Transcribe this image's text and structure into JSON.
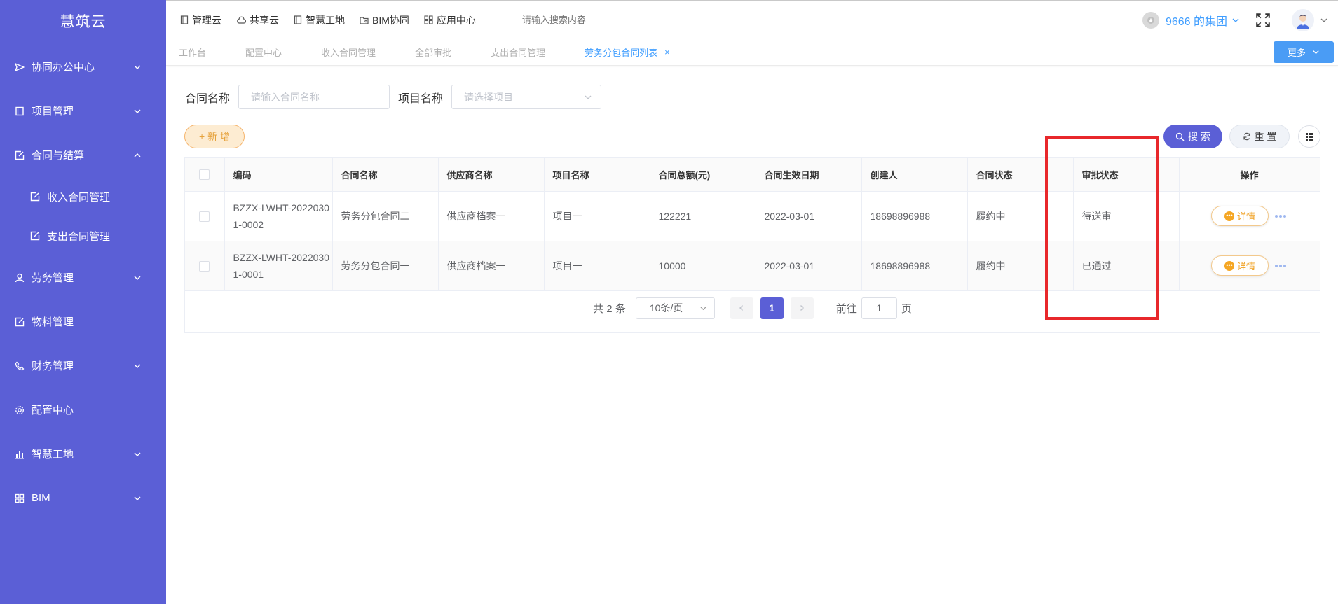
{
  "app": {
    "logo": "慧筑云"
  },
  "sidebar": {
    "items": [
      {
        "label": "协同办公中心",
        "icon": "send-icon",
        "expanded": false,
        "has_children": true
      },
      {
        "label": "项目管理",
        "icon": "book-icon",
        "expanded": false,
        "has_children": true
      },
      {
        "label": "合同与结算",
        "icon": "edit-doc-icon",
        "expanded": true,
        "has_children": true,
        "children": [
          {
            "label": "收入合同管理",
            "icon": "edit-doc-icon"
          },
          {
            "label": "支出合同管理",
            "icon": "edit-doc-icon"
          }
        ]
      },
      {
        "label": "劳务管理",
        "icon": "user-icon",
        "expanded": false,
        "has_children": true
      },
      {
        "label": "物料管理",
        "icon": "edit-doc-icon",
        "has_children": false
      },
      {
        "label": "财务管理",
        "icon": "phone-icon",
        "expanded": false,
        "has_children": true
      },
      {
        "label": "配置中心",
        "icon": "gear-icon",
        "has_children": false
      },
      {
        "label": "智慧工地",
        "icon": "bar-chart-icon",
        "expanded": false,
        "has_children": true
      },
      {
        "label": "BIM",
        "icon": "grid-icon",
        "expanded": false,
        "has_children": true
      }
    ]
  },
  "topnav": {
    "items": [
      {
        "label": "管理云",
        "icon": "doc-icon"
      },
      {
        "label": "共享云",
        "icon": "cloud-icon"
      },
      {
        "label": "智慧工地",
        "icon": "doc-icon"
      },
      {
        "label": "BIM协同",
        "icon": "folder-icon"
      },
      {
        "label": "应用中心",
        "icon": "apps-icon"
      }
    ],
    "search_placeholder": "请输入搜索内容",
    "org_name": "9666 的集团"
  },
  "tabs": {
    "items": [
      {
        "label": "工作台",
        "active": false
      },
      {
        "label": "配置中心",
        "active": false
      },
      {
        "label": "收入合同管理",
        "active": false
      },
      {
        "label": "全部审批",
        "active": false
      },
      {
        "label": "支出合同管理",
        "active": false
      },
      {
        "label": "劳务分包合同列表",
        "active": true,
        "closable": true
      }
    ],
    "more_label": "更多"
  },
  "filters": {
    "contract_name_label": "合同名称",
    "contract_name_placeholder": "请输入合同名称",
    "project_name_label": "项目名称",
    "project_name_placeholder": "请选择项目"
  },
  "actions": {
    "add_label": "+ 新 增",
    "search_label": "搜 索",
    "reset_label": "重 置"
  },
  "table": {
    "columns": [
      "编码",
      "合同名称",
      "供应商名称",
      "项目名称",
      "合同总额(元)",
      "合同生效日期",
      "创建人",
      "合同状态",
      "审批状态",
      "操作"
    ],
    "rows": [
      {
        "code": "BZZX-LWHT-20220301-0002",
        "name": "劳务分包合同二",
        "supplier": "供应商档案一",
        "project": "项目一",
        "amount": "122221",
        "date": "2022-03-01",
        "creator": "18698896988",
        "status": "履约中",
        "approval": "待送审",
        "action": "详情"
      },
      {
        "code": "BZZX-LWHT-20220301-0001",
        "name": "劳务分包合同一",
        "supplier": "供应商档案一",
        "project": "项目一",
        "amount": "10000",
        "date": "2022-03-01",
        "creator": "18698896988",
        "status": "履约中",
        "approval": "已通过",
        "action": "详情"
      }
    ]
  },
  "pager": {
    "total_text": "共 2 条",
    "page_size": "10条/页",
    "current_page": "1",
    "goto_prefix": "前往",
    "goto_value": "1",
    "goto_suffix": "页"
  },
  "colors": {
    "sidebar": "#5b5fd6",
    "accent": "#409eff",
    "primary": "#5b5fd6",
    "warning": "#e6a23c",
    "highlight": "#e8282b"
  }
}
